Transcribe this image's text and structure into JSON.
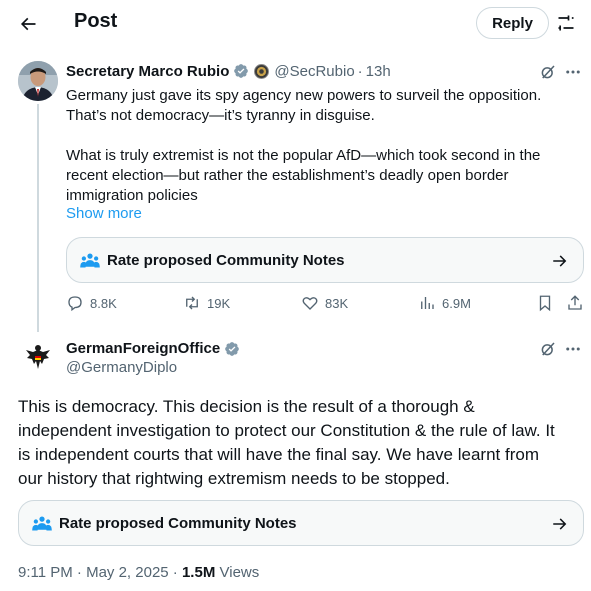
{
  "header": {
    "title": "Post",
    "reply_label": "Reply",
    "back_icon": "arrow-left-icon",
    "filter_icon": "sliders-icon"
  },
  "parent_post": {
    "author_name": "Secretary Marco Rubio",
    "handle": "@SecRubio",
    "separator": "·",
    "time": "13h",
    "body_line1": "Germany just gave its spy agency new powers to surveil the opposition.",
    "body_line2": "That’s not democracy—it’s tyranny in disguise.",
    "body_line3": "What is truly extremist is not the popular AfD—which took second in the",
    "body_line4": "recent election—but rather the establishment’s deadly open border",
    "body_line5": "immigration policies",
    "show_more": "Show more",
    "community_notes_label": "Rate proposed Community Notes",
    "replies": "8.8K",
    "reposts": "19K",
    "likes": "83K",
    "views": "6.9M"
  },
  "reply_post": {
    "author_name": "GermanForeignOffice",
    "handle": "@GermanyDiplo",
    "body_line1": "This is democracy. This decision is the result of a thorough &",
    "body_line2": "independent investigation to protect our Constitution & the rule of law. It",
    "body_line3": "is independent courts that will have the final say. We have learnt from",
    "body_line4": "our history that rightwing extremism needs to be stopped.",
    "community_notes_label": "Rate proposed Community Notes",
    "timestamp": "9:11 PM · May 2, 2025 ·",
    "view_count": "1.5M",
    "views_label": "Views"
  },
  "colors": {
    "text": "#0f1419",
    "secondary": "#536471",
    "accent": "#1d9bf0",
    "border": "#cfd9de",
    "card_bg": "#f7f9f9"
  }
}
